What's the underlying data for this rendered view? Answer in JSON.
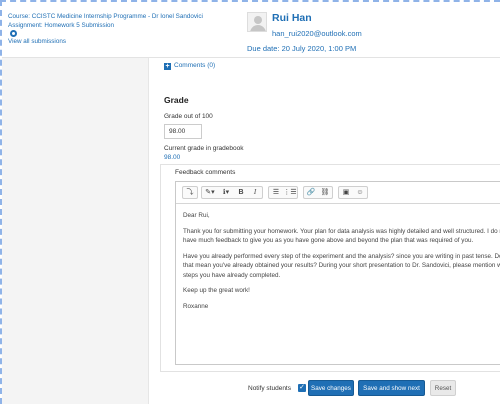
{
  "header": {
    "course": "Course: CCISTC Medicine Internship Programme - Dr Ionel Sandovici",
    "assignment": "Assignment: Homework 5 Submission",
    "view_all": "View all submissions",
    "user_name": "Rui Han",
    "user_email": "han_rui2020@outlook.com",
    "due_date": "Due date: 20 July 2020, 1:00 PM"
  },
  "comments": {
    "link": "Comments (0)",
    "icon": "+"
  },
  "grade": {
    "heading": "Grade",
    "out_of_label": "Grade out of 100",
    "value": "98.00",
    "current_label": "Current grade in gradebook",
    "current_value": "98.00"
  },
  "feedback": {
    "label": "Feedback comments",
    "toolbar": {
      "show_more": "⤵",
      "paint": "✎▾",
      "info": "ℹ▾",
      "bold": "B",
      "italic": "I",
      "bullets": "☰",
      "numbered": "⋮☰",
      "link": "🔗",
      "unlink": "⛓",
      "image": "▣",
      "emoji": "☺"
    },
    "lines": [
      "Dear Rui,",
      "Thank you for submitting your homework. Your plan for data analysis was highly detailed and well structured. I do not",
      "have much feedback to give you as you have gone above and beyond the plan that was required of you.",
      "Have you already performed every step of the experiment and the analysis? since you are writing in past tense. Does",
      "that mean you've already obtained your results? During your short presentation to Dr. Sandovici, please mention which",
      "steps you have already completed.",
      "Keep up the great work!",
      "Roxanne"
    ]
  },
  "footer": {
    "notify_label": "Notify students",
    "notify_check": "✓",
    "save": "Save changes",
    "save_next": "Save and show next",
    "reset": "Reset"
  }
}
